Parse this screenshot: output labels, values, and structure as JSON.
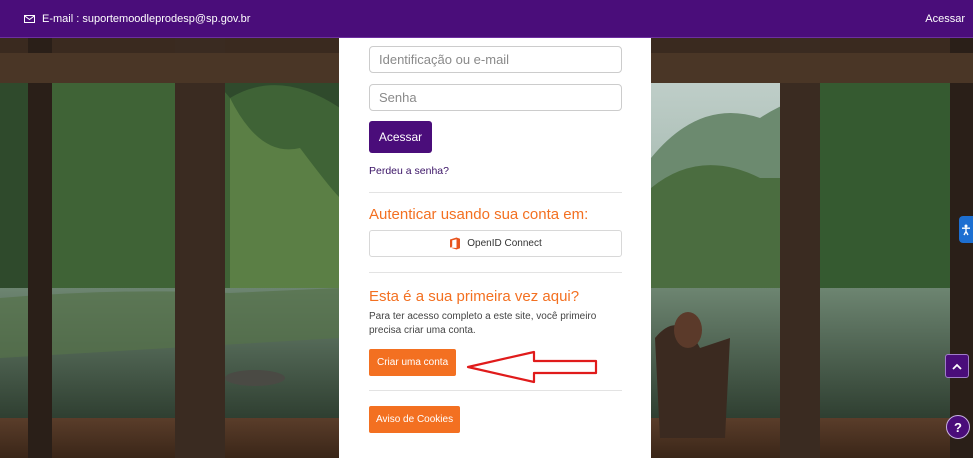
{
  "navbar": {
    "email_text": "E-mail : suportemoodleprodesp@sp.gov.br",
    "login_link": "Acessar",
    "email_icon": "envelope-icon"
  },
  "login": {
    "username_placeholder": "Identificação ou e-mail",
    "password_placeholder": "Senha",
    "submit_label": "Acessar",
    "forgot_link": "Perdeu a senha?"
  },
  "auth": {
    "heading": "Autenticar usando sua conta em:",
    "provider_label": "OpenID Connect",
    "provider_icon": "microsoft-office-icon"
  },
  "signup": {
    "heading": "Esta é a sua primeira vez aqui?",
    "description": "Para ter acesso completo a este site, você primeiro precisa criar uma conta.",
    "create_label": "Criar uma conta"
  },
  "cookies": {
    "label": "Aviso de Cookies"
  },
  "floating": {
    "accessibility_icon": "accessibility-icon",
    "scroll_top_icon": "chevron-up-icon",
    "help_label": "?"
  },
  "colors": {
    "brand_purple": "#4a0d7a",
    "accent_orange": "#f37021",
    "annotation_red": "#e01b1b"
  }
}
